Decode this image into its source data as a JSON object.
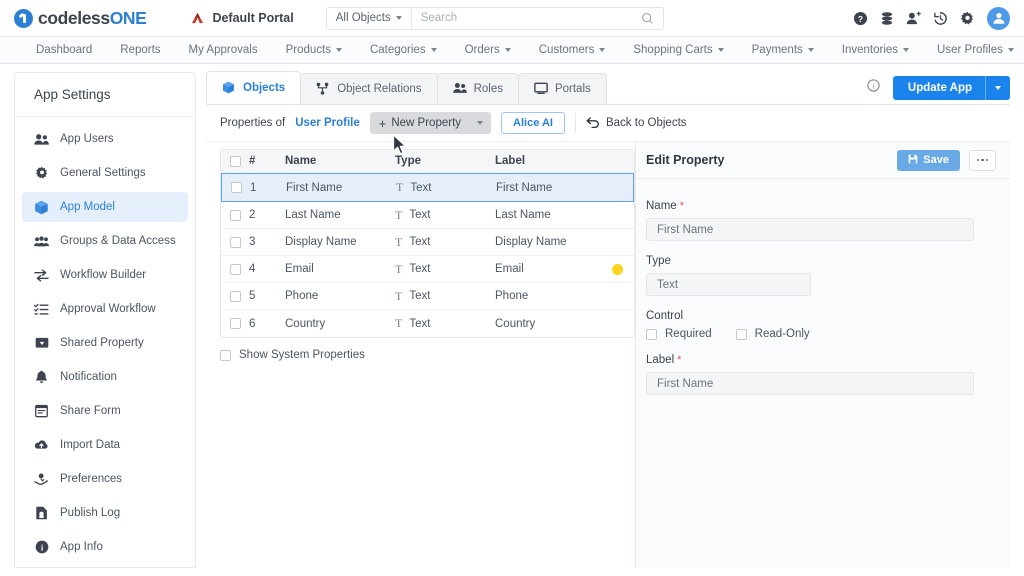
{
  "header": {
    "logo_a": "codeless",
    "logo_b": "ONE",
    "portal_name": "Default Portal",
    "object_filter": "All Objects",
    "search_placeholder": "Search",
    "search_value": "",
    "icons": [
      "help-icon",
      "database-icon",
      "add-user-icon",
      "history-icon",
      "settings-icon",
      "avatar"
    ]
  },
  "nav": {
    "items": [
      {
        "label": "Dashboard",
        "has_caret": false
      },
      {
        "label": "Reports",
        "has_caret": false
      },
      {
        "label": "My Approvals",
        "has_caret": false
      },
      {
        "label": "Products",
        "has_caret": true
      },
      {
        "label": "Categories",
        "has_caret": true
      },
      {
        "label": "Orders",
        "has_caret": true
      },
      {
        "label": "Customers",
        "has_caret": true
      },
      {
        "label": "Shopping Carts",
        "has_caret": true
      },
      {
        "label": "Payments",
        "has_caret": true
      },
      {
        "label": "Inventories",
        "has_caret": true
      },
      {
        "label": "User Profiles",
        "has_caret": true
      }
    ]
  },
  "sidebar": {
    "title": "App Settings",
    "items": [
      {
        "label": "App Users",
        "icon": "users-icon",
        "active": false
      },
      {
        "label": "General Settings",
        "icon": "gear-icon",
        "active": false
      },
      {
        "label": "App Model",
        "icon": "cube-icon",
        "active": true
      },
      {
        "label": "Groups & Data Access",
        "icon": "group-icon",
        "active": false
      },
      {
        "label": "Workflow Builder",
        "icon": "arrows-icon",
        "active": false
      },
      {
        "label": "Approval Workflow",
        "icon": "checklist-icon",
        "active": false
      },
      {
        "label": "Shared Property",
        "icon": "share-property-icon",
        "active": false
      },
      {
        "label": "Notification",
        "icon": "bell-icon",
        "active": false
      },
      {
        "label": "Share Form",
        "icon": "form-icon",
        "active": false
      },
      {
        "label": "Import Data",
        "icon": "cloud-upload-icon",
        "active": false
      },
      {
        "label": "Preferences",
        "icon": "preferences-icon",
        "active": false
      },
      {
        "label": "Publish Log",
        "icon": "publish-log-icon",
        "active": false
      },
      {
        "label": "App Info",
        "icon": "info-icon",
        "active": false
      }
    ]
  },
  "tabs": [
    {
      "label": "Objects",
      "icon": "cube-icon",
      "active": true
    },
    {
      "label": "Object Relations",
      "icon": "relations-icon",
      "active": false
    },
    {
      "label": "Roles",
      "icon": "roles-icon",
      "active": false
    },
    {
      "label": "Portals",
      "icon": "portal-icon",
      "active": false
    }
  ],
  "tab_actions": {
    "info_icon": "info-icon",
    "update_app_label": "Update App"
  },
  "toolbar": {
    "properties_of": "Properties of",
    "object_name": "User Profile",
    "new_property_label": "New Property",
    "alice_label": "Alice AI",
    "back_label": "Back to Objects"
  },
  "table": {
    "columns": [
      "#",
      "Name",
      "Type",
      "Label"
    ],
    "rows": [
      {
        "num": "1",
        "name": "First Name",
        "type": "Text",
        "label": "First Name",
        "selected": true,
        "dot": ""
      },
      {
        "num": "2",
        "name": "Last Name",
        "type": "Text",
        "label": "Last Name",
        "selected": false,
        "dot": ""
      },
      {
        "num": "3",
        "name": "Display Name",
        "type": "Text",
        "label": "Display Name",
        "selected": false,
        "dot": ""
      },
      {
        "num": "4",
        "name": "Email",
        "type": "Text",
        "label": "Email",
        "selected": false,
        "dot": "#FFD21E"
      },
      {
        "num": "5",
        "name": "Phone",
        "type": "Text",
        "label": "Phone",
        "selected": false,
        "dot": ""
      },
      {
        "num": "6",
        "name": "Country",
        "type": "Text",
        "label": "Country",
        "selected": false,
        "dot": ""
      }
    ],
    "show_system_properties": "Show System Properties"
  },
  "edit_panel": {
    "title": "Edit Property",
    "save_label": "Save",
    "name_label": "Name",
    "name_value": "First Name",
    "type_label": "Type",
    "type_value": "Text",
    "control_label": "Control",
    "required_label": "Required",
    "readonly_label": "Read-Only",
    "label_label": "Label",
    "label_value": "First Name"
  },
  "colors": {
    "accent": "#1a84ec",
    "link": "#2b7fd4",
    "sidebar_active_bg": "#e5effb",
    "row_selected_bg": "#e6eff9",
    "dot_yellow": "#FFD21E"
  }
}
